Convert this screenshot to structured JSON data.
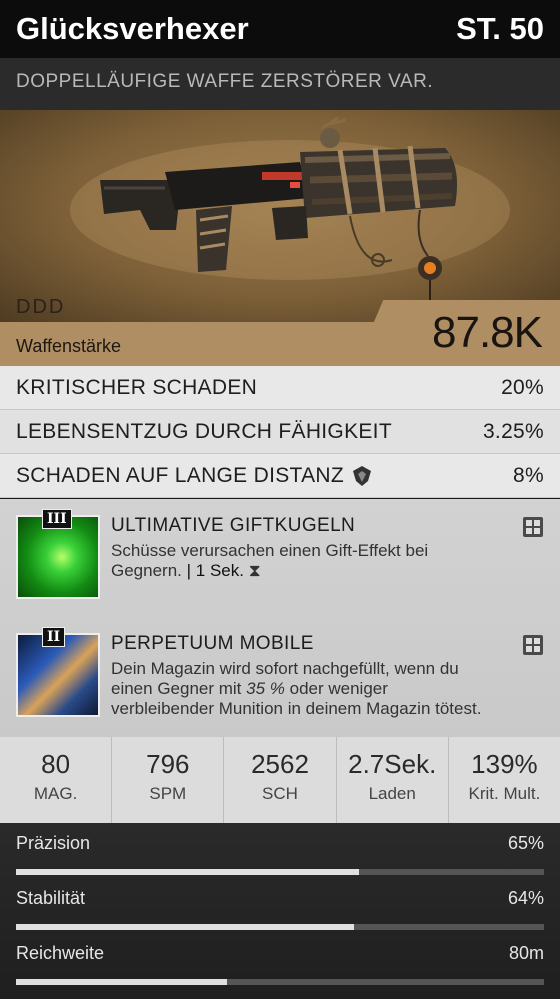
{
  "weapon": {
    "name": "Glücksverhexer",
    "level": "ST. 50",
    "type": "DOPPELLÄUFIGE WAFFE ZERSTÖRER VAR.",
    "rarity_marks": "DDD",
    "power_label": "Waffenstärke",
    "power_value": "87.8K"
  },
  "stats": [
    {
      "label": "KRITISCHER SCHADEN",
      "value": "20%"
    },
    {
      "label": "LEBENSENTZUG DURCH FÄHIGKEIT",
      "value": "3.25%"
    },
    {
      "label": "SCHADEN AUF LANGE DISTANZ",
      "value": "8%",
      "icon": "shield-icon"
    }
  ],
  "perks": [
    {
      "tier": "III",
      "title": "ULTIMATIVE GIFTKUGELN",
      "desc_1": "Schüsse verursachen einen Gift-Effekt bei",
      "desc_2": "Gegnern.",
      "duration": "| 1 Sek.",
      "icon": "grid-icon",
      "color": "#2fbf2f"
    },
    {
      "tier": "II",
      "title": "PERPETUUM MOBILE",
      "desc_1": "Dein Magazin wird sofort nachgefüllt, wenn du",
      "desc_2a": "einen Gegner mit ",
      "desc_2b": "35 %",
      "desc_2c": " oder weniger",
      "desc_3": "verbleibender Munition in deinem Magazin tötest.",
      "icon": "grid-icon",
      "color": "#1e3c78"
    }
  ],
  "metrics": [
    {
      "value": "80",
      "label": "MAG."
    },
    {
      "value": "796",
      "label": "SPM"
    },
    {
      "value": "2562",
      "label": "SCH"
    },
    {
      "value": "2.7Sek.",
      "label": "Laden"
    },
    {
      "value": "139%",
      "label": "Krit. Mult."
    }
  ],
  "bars": [
    {
      "label": "Präzision",
      "value": "65%",
      "fraction": 0.65
    },
    {
      "label": "Stabilität",
      "value": "64%",
      "fraction": 0.64
    },
    {
      "label": "Reichweite",
      "value": "80m",
      "fraction": 0.4
    }
  ],
  "colors": {
    "hero_bg": "#8a6a40",
    "power_bg": "#b08e63"
  }
}
